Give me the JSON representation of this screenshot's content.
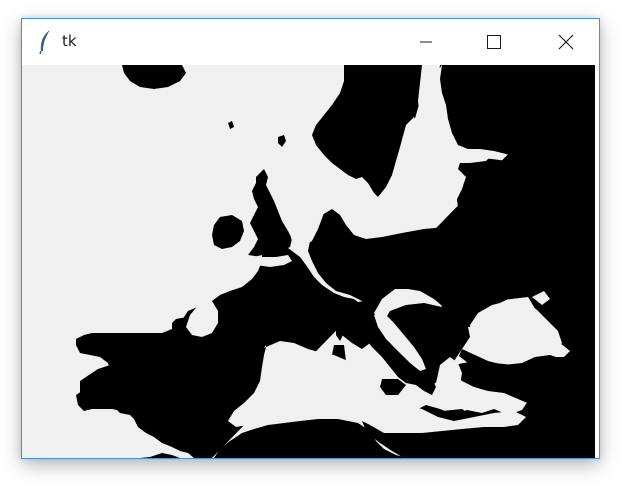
{
  "window": {
    "title": "tk",
    "icon": "feather-icon",
    "controls": [
      "minimize-icon",
      "maximize-icon",
      "close-icon"
    ],
    "accent_color": "#4a90d9"
  },
  "map": {
    "region": "Europe",
    "land_color": "#000000",
    "water_color": "#f0f0f0"
  }
}
